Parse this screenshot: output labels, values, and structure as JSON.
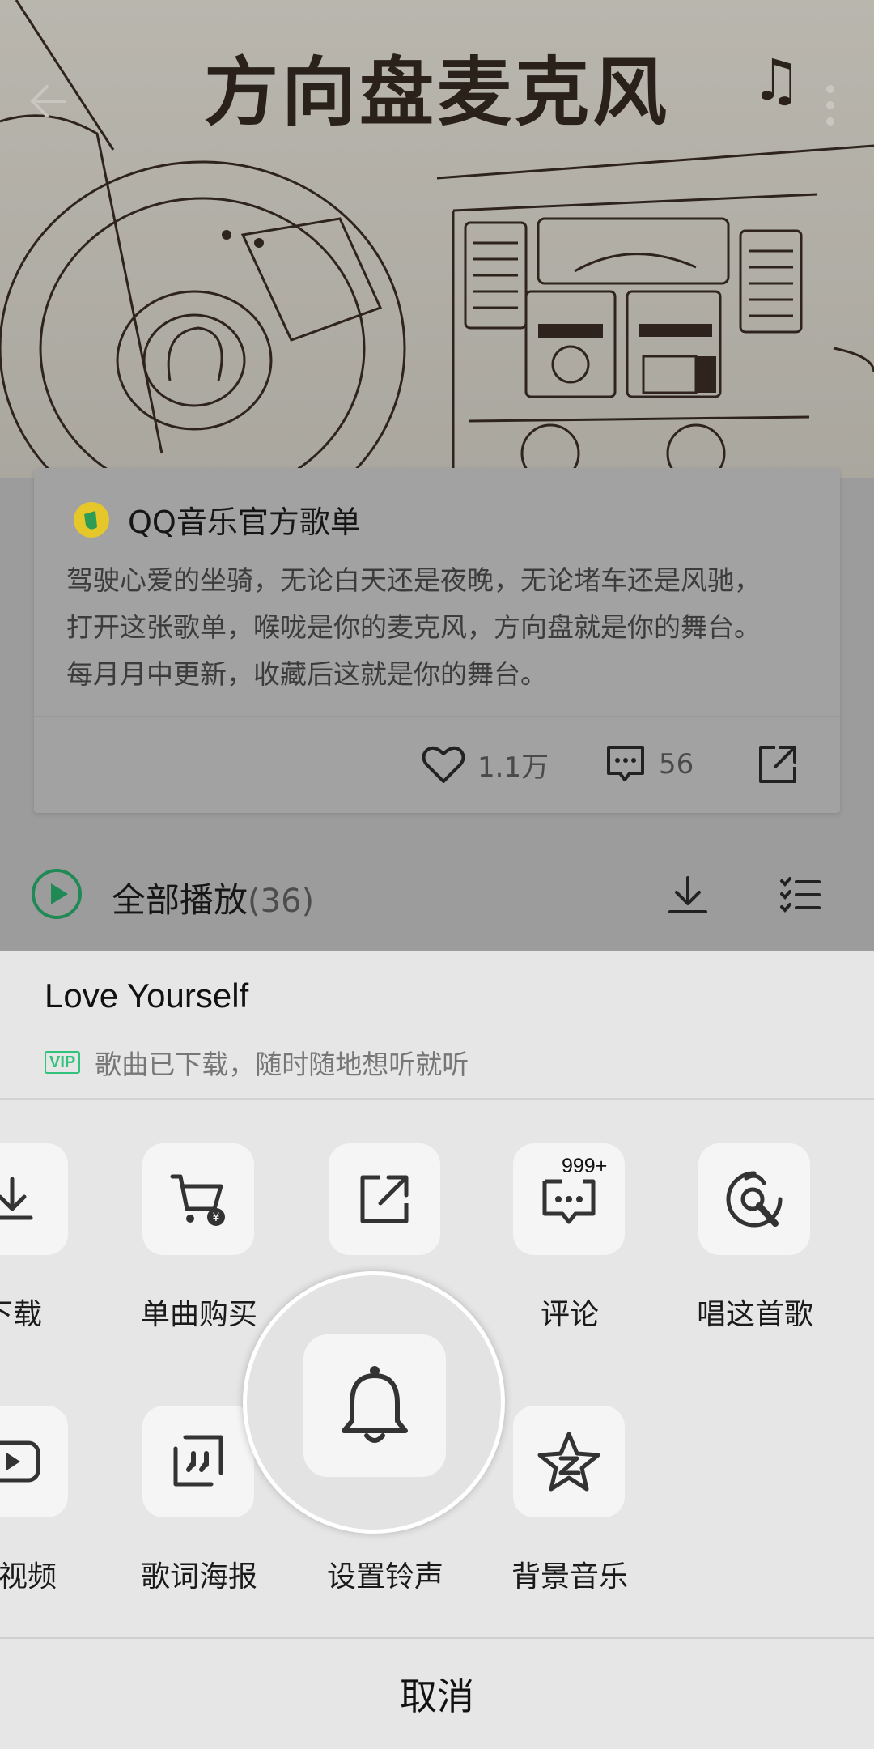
{
  "hero": {
    "title": "方向盘麦克风",
    "note_glyph": "♫"
  },
  "playlist": {
    "author": "QQ音乐官方歌单",
    "description_lines": [
      "驾驶心爱的坐骑，无论白天还是夜晚，无论堵车还是风驰，",
      "打开这张歌单，喉咙是你的麦克风，方向盘就是你的舞台。",
      "每月月中更新，收藏后这就是你的舞台。"
    ],
    "likes": "1.1万",
    "comments": "56",
    "play_all_label": "全部播放",
    "play_all_count": "(36)"
  },
  "sheet": {
    "song_title": "Love Yourself",
    "vip_badge": "VIP",
    "subtitle": "歌曲已下载，随时随地想听就听",
    "actions_row1": [
      {
        "label": "下载",
        "icon": "download-icon"
      },
      {
        "label": "单曲购买",
        "icon": "cart-icon"
      },
      {
        "label": "",
        "icon": "share-icon"
      },
      {
        "label": "评论",
        "icon": "comment-icon",
        "badge": "999+"
      },
      {
        "label": "唱这首歌",
        "icon": "karaoke-icon"
      }
    ],
    "actions_row2": [
      {
        "label": "放视频",
        "icon": "video-icon"
      },
      {
        "label": "歌词海报",
        "icon": "lyric-poster-icon"
      },
      {
        "label": "设置铃声",
        "icon": "bell-icon"
      },
      {
        "label": "背景音乐",
        "icon": "qzone-star-icon"
      }
    ],
    "cancel_label": "取消"
  },
  "colors": {
    "accent_green": "#31c27c",
    "sheet_bg": "#e6e6e6",
    "dim_bg": "#9c9c9c"
  }
}
